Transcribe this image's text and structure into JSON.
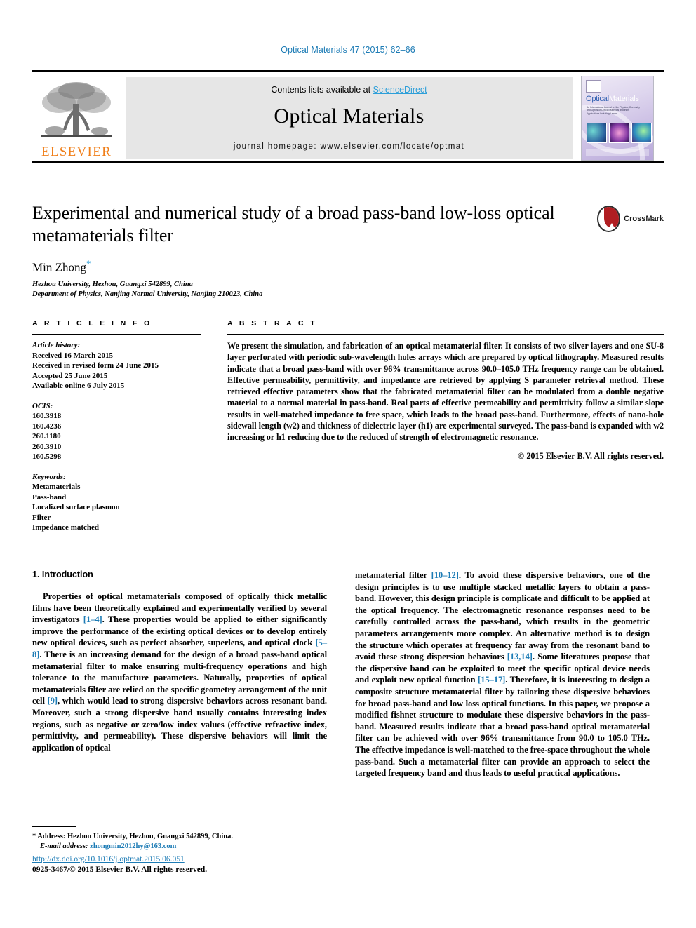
{
  "running_head": "Optical Materials 47 (2015) 62–66",
  "masthead": {
    "contents_prefix": "Contents lists available at ",
    "sciencedirect": "ScienceDirect",
    "journal_title": "Optical Materials",
    "homepage": "journal homepage: www.elsevier.com/locate/optmat",
    "publisher_logo_text": "ELSEVIER",
    "cover": {
      "title_part1": "Optical",
      "title_part2": "Materials",
      "subtitle": "An International Journal on the Physics, Chemistry and Optics of Optical Materials and their Applications Including Lasers"
    }
  },
  "article": {
    "title": "Experimental and numerical study of a broad pass-band low-loss optical metamaterials filter",
    "crossmark_label": "CrossMark",
    "author": "Min Zhong",
    "author_marker": "*",
    "affiliations": [
      "Hezhou University, Hezhou, Guangxi 542899, China",
      "Department of Physics, Nanjing Normal University, Nanjing 210023, China"
    ]
  },
  "article_info": {
    "heading": "A R T I C L E   I N F O",
    "history_label": "Article history:",
    "history": [
      "Received 16 March 2015",
      "Received in revised form 24 June 2015",
      "Accepted 25 June 2015",
      "Available online 6 July 2015"
    ],
    "ocis_label": "OCIS:",
    "ocis": [
      "160.3918",
      "160.4236",
      "260.1180",
      "260.3910",
      "160.5298"
    ],
    "keywords_label": "Keywords:",
    "keywords": [
      "Metamaterials",
      "Pass-band",
      "Localized surface plasmon",
      "Filter",
      "Impedance matched"
    ]
  },
  "abstract": {
    "heading": "A B S T R A C T",
    "text": "We present the simulation, and fabrication of an optical metamaterial filter. It consists of two silver layers and one SU-8 layer perforated with periodic sub-wavelength holes arrays which are prepared by optical lithography. Measured results indicate that a broad pass-band with over 96% transmittance across 90.0–105.0 THz frequency range can be obtained. Effective permeability, permittivity, and impedance are retrieved by applying S parameter retrieval method. These retrieved effective parameters show that the fabricated metamaterial filter can be modulated from a double negative material to a normal material in pass-band. Real parts of effective permeability and permittivity follow a similar slope results in well-matched impedance to free space, which leads to the broad pass-band. Furthermore, effects of nano-hole sidewall length (w2) and thickness of dielectric layer (h1) are experimental surveyed. The pass-band is expanded with w2 increasing or h1 reducing due to the reduced of strength of electromagnetic resonance.",
    "copyright": "© 2015 Elsevier B.V. All rights reserved."
  },
  "body": {
    "section_heading": "1. Introduction",
    "left_paragraph_a": "Properties of optical metamaterials composed of optically thick metallic films have been theoretically explained and experimentally verified by several investigators ",
    "ref_1_4": "[1–4]",
    "left_paragraph_b": ". These properties would be applied to either significantly improve the performance of the existing optical devices or to develop entirely new optical devices, such as perfect absorber, superlens, and optical clock ",
    "ref_5_8": "[5–8]",
    "left_paragraph_c": ". There is an increasing demand for the design of a broad pass-band optical metamaterial filter to make ensuring multi-frequency operations and high tolerance to the manufacture parameters. Naturally, properties of optical metamaterials filter are relied on the specific geometry arrangement of the unit cell ",
    "ref_9": "[9]",
    "left_paragraph_d": ", which would lead to strong dispersive behaviors across resonant band. Moreover, such a strong dispersive band usually contains interesting index regions, such as negative or zero/low index values (effective refractive index, permittivity, and permeability). These dispersive behaviors will limit the application of optical",
    "right_paragraph_a": "metamaterial filter ",
    "ref_10_12": "[10–12]",
    "right_paragraph_b": ". To avoid these dispersive behaviors, one of the design principles is to use multiple stacked metallic layers to obtain a pass-band. However, this design principle is complicate and difficult to be applied at the optical frequency. The electromagnetic resonance responses need to be carefully controlled across the pass-band, which results in the geometric parameters arrangements more complex. An alternative method is to design the structure which operates at frequency far away from the resonant band to avoid these strong dispersion behaviors ",
    "ref_13_14": "[13,14]",
    "right_paragraph_c": ". Some literatures propose that the dispersive band can be exploited to meet the specific optical device needs and exploit new optical function ",
    "ref_15_17": "[15–17]",
    "right_paragraph_d": ". Therefore, it is interesting to design a composite structure metamaterial filter by tailoring these dispersive behaviors for broad pass-band and low loss optical functions. In this paper, we propose a modified fishnet structure to modulate these dispersive behaviors in the pass-band. Measured results indicate that a broad pass-band optical metamaterial filter can be achieved with over 96% transmittance from 90.0 to 105.0 THz. The effective impedance is well-matched to the free-space throughout the whole pass-band. Such a metamaterial filter can provide an approach to select the targeted frequency band and thus leads to useful practical applications."
  },
  "footnote": {
    "marker": "*",
    "address": "Address: Hezhou University, Hezhou, Guangxi 542899, China.",
    "email_label": "E-mail address:",
    "email": "zhongmin2012hy@163.com"
  },
  "footer": {
    "doi": "http://dx.doi.org/10.1016/j.optmat.2015.06.051",
    "issn": "0925-3467/© 2015 Elsevier B.V. All rights reserved."
  },
  "colors": {
    "link": "#1c7bb5",
    "sciencedirect": "#2d9fd9",
    "elsevier_orange": "#f07f1a",
    "band_gray": "#e6e6e6"
  }
}
